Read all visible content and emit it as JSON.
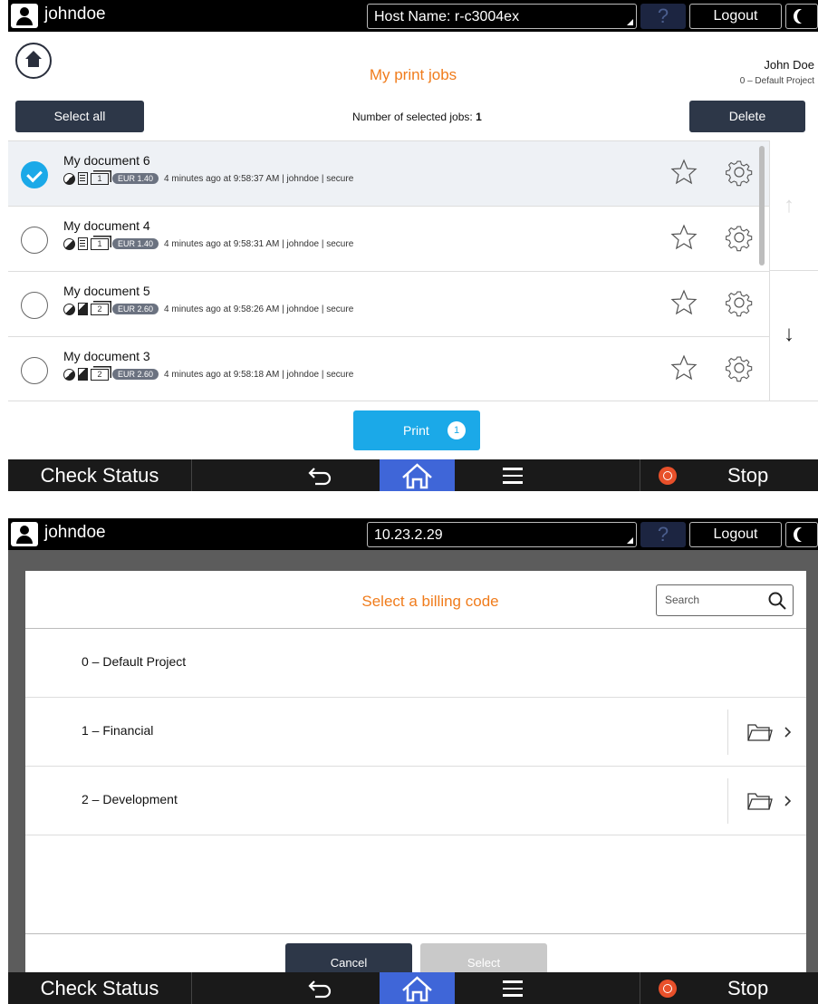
{
  "screen1": {
    "topbar": {
      "username": "johndoe",
      "host": "Host Name: r-c3004ex",
      "help": "?",
      "logout": "Logout"
    },
    "header": {
      "title": "My print jobs",
      "user_name": "John Doe",
      "project": "0 – Default Project"
    },
    "toolbar": {
      "select_all": "Select all",
      "selected_label": "Number of selected jobs:",
      "selected_count": "1",
      "delete": "Delete"
    },
    "jobs": [
      {
        "title": "My document 6",
        "copies": "1",
        "price": "EUR 1.40",
        "time": "4 minutes ago at 9:58:37 AM",
        "user": "johndoe",
        "mode": "secure"
      },
      {
        "title": "My document 4",
        "copies": "1",
        "price": "EUR 1.40",
        "time": "4 minutes ago at 9:58:31 AM",
        "user": "johndoe",
        "mode": "secure"
      },
      {
        "title": "My document 5",
        "copies": "2",
        "price": "EUR 2.60",
        "time": "4 minutes ago at 9:58:26 AM",
        "user": "johndoe",
        "mode": "secure"
      },
      {
        "title": "My document 3",
        "copies": "2",
        "price": "EUR 2.60",
        "time": "4 minutes ago at 9:58:18 AM",
        "user": "johndoe",
        "mode": "secure"
      }
    ],
    "print": {
      "label": "Print",
      "badge": "1"
    },
    "bottombar": {
      "check_status": "Check Status",
      "stop": "Stop"
    }
  },
  "screen2": {
    "topbar": {
      "username": "johndoe",
      "host": "10.23.2.29",
      "help": "?",
      "logout": "Logout"
    },
    "modal": {
      "title": "Select a billing code",
      "search_placeholder": "Search",
      "codes": [
        {
          "label": "0 – Default Project"
        },
        {
          "label": "1 – Financial"
        },
        {
          "label": "2 – Development"
        }
      ],
      "cancel": "Cancel",
      "select": "Select"
    },
    "bottombar": {
      "check_status": "Check Status",
      "stop": "Stop"
    }
  },
  "colors": {
    "accent_orange": "#f07c1c",
    "accent_blue": "#1ba9e8",
    "home_blue": "#3f66d8",
    "stop_red": "#e8502a",
    "dark_button": "#2d3748"
  }
}
